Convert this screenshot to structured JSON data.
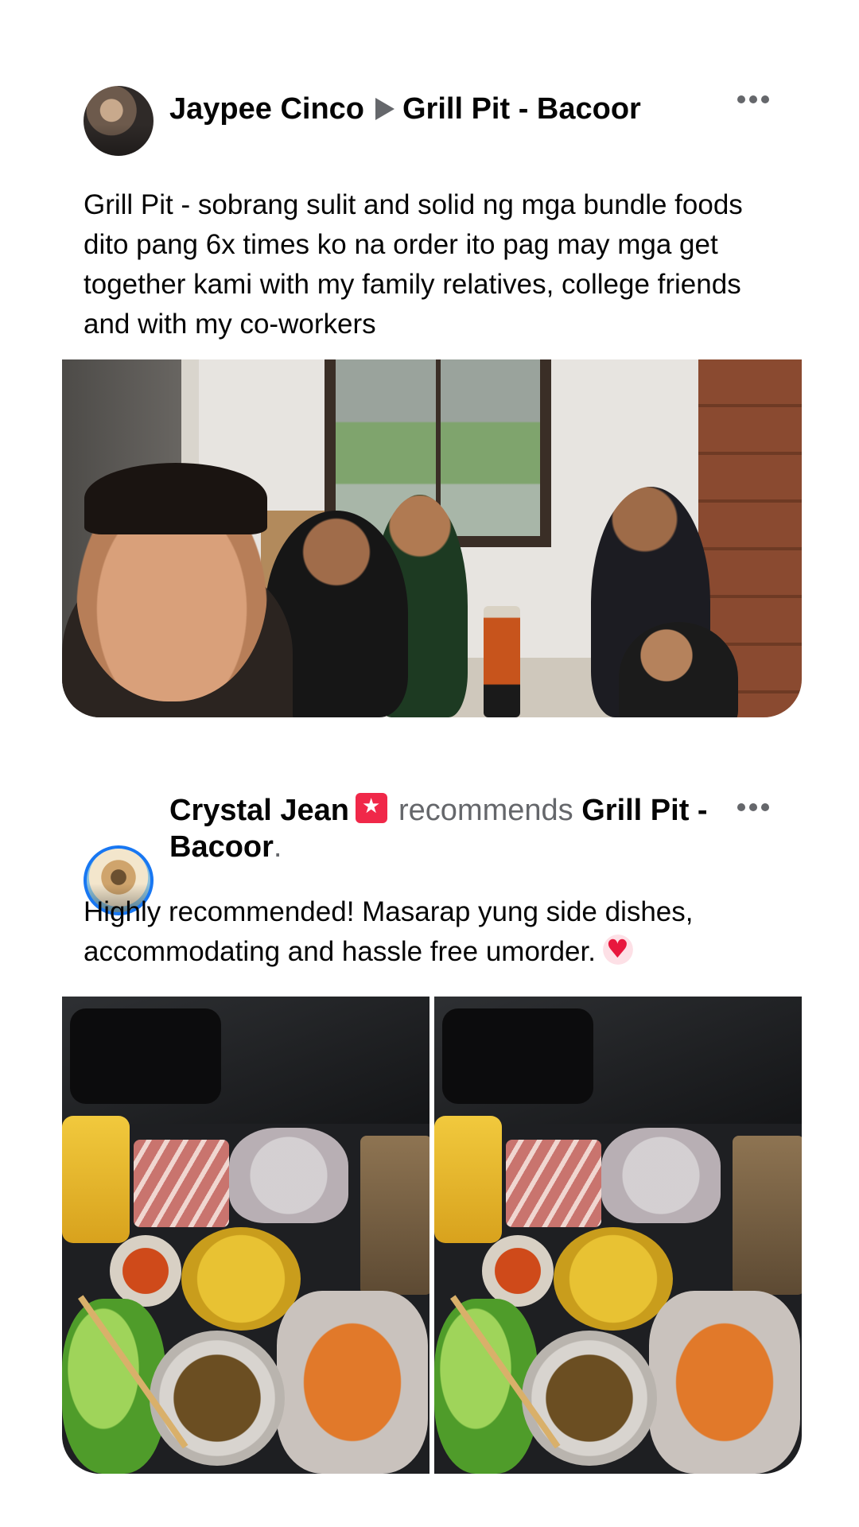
{
  "posts": [
    {
      "author": "Jaypee Cinco",
      "page": "Grill Pit - Bacoor",
      "text": "Grill Pit - sobrang sulit and solid ng mga bundle foods dito pang 6x times ko na order ito pag may mga get together kami with my family relatives, college friends and with my co-workers"
    },
    {
      "author": "Crystal Jean",
      "action": "recommends",
      "page_part1": "Grill Pit",
      "page_part2": "- Bacoor",
      "period": ".",
      "text": "Highly recommended! Masarap yung side dishes, accommodating and hassle free umorder."
    }
  ],
  "icons": {
    "more": "more-horizontal-icon",
    "arrow": "play-arrow-icon",
    "recommend": "recommend-star-icon",
    "heart": "heart-emoji-icon"
  },
  "colors": {
    "text": "#050505",
    "muted": "#65676b",
    "recommend_badge": "#f02849",
    "avatar_ring": "#1877f2"
  }
}
